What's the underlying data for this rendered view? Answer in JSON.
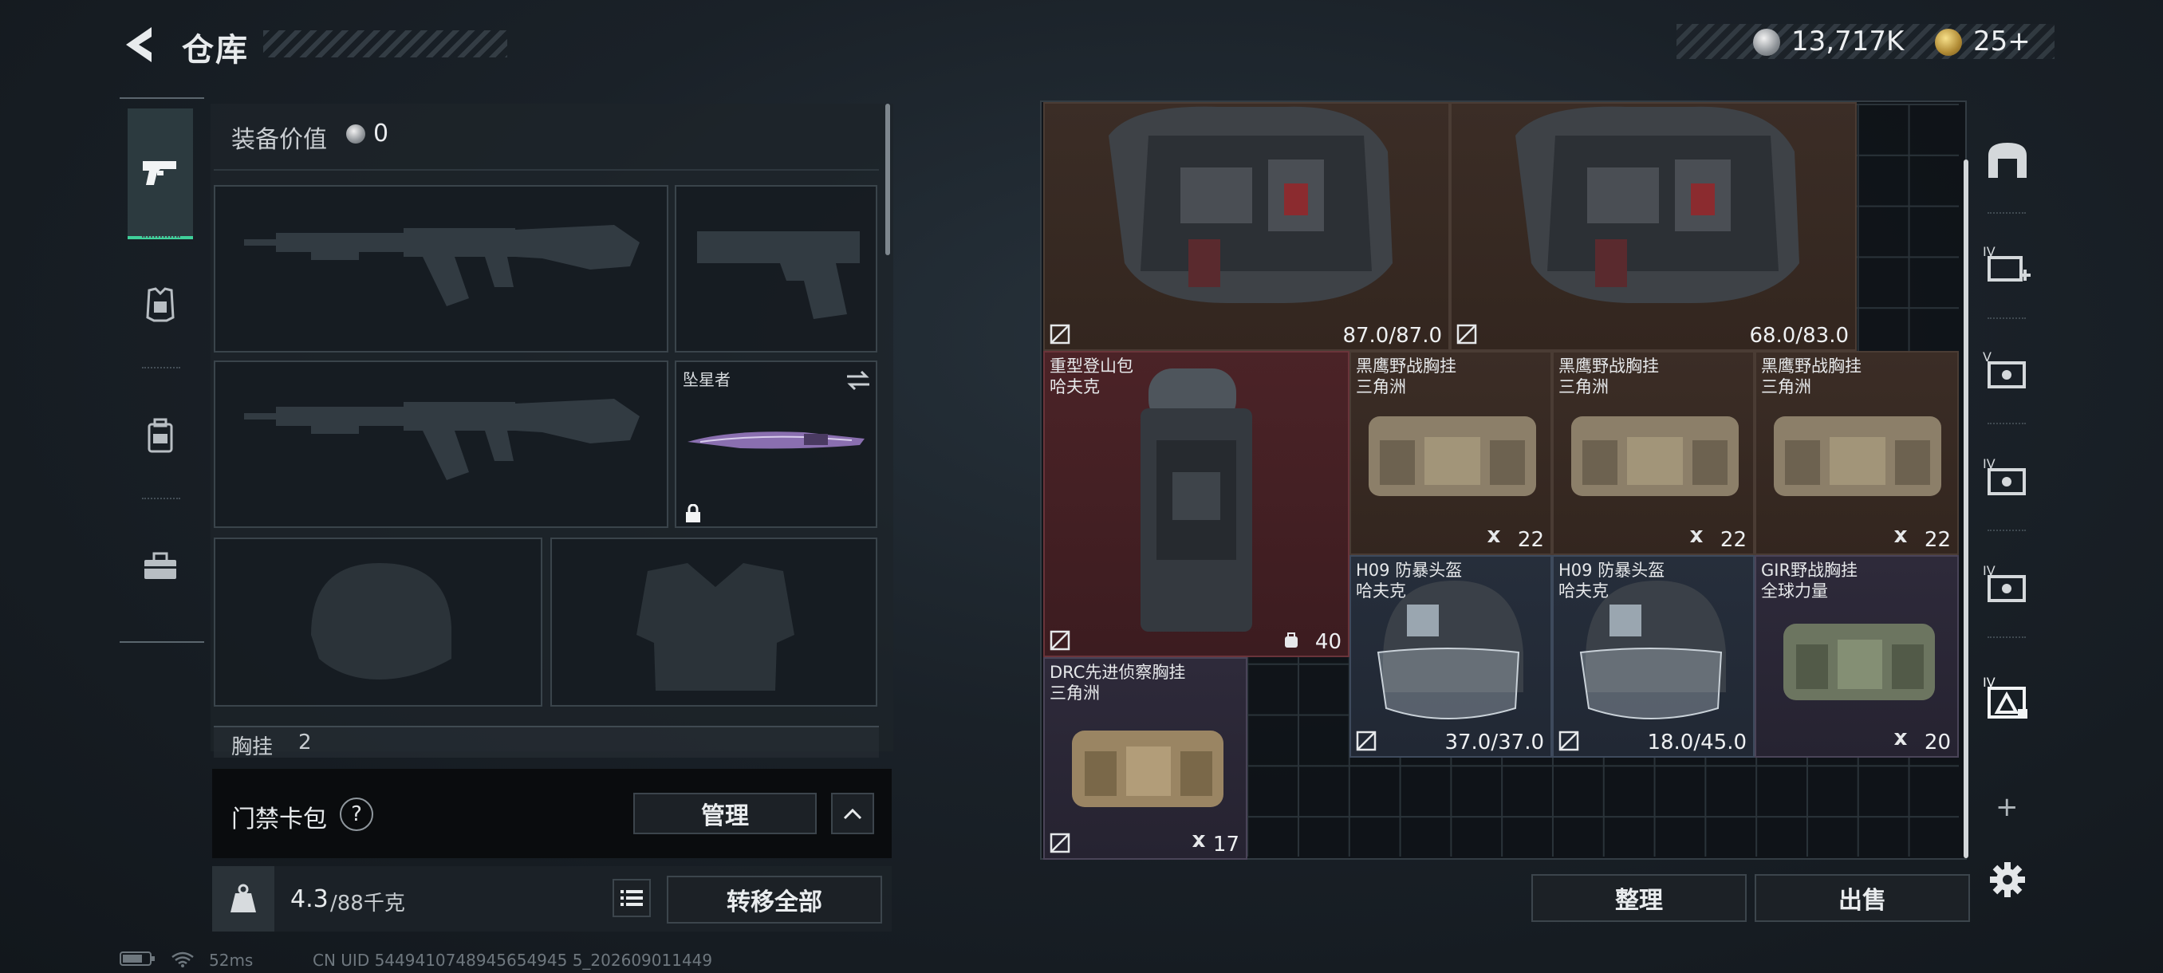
{
  "header": {
    "title": "仓库",
    "currency_primary": "13,717K",
    "currency_secondary": "25+"
  },
  "left_nav": {
    "tabs": [
      {
        "name": "weapon",
        "icon": "pistol-icon",
        "active": true
      },
      {
        "name": "armor",
        "icon": "armor-vest-icon",
        "active": false
      },
      {
        "name": "backpack",
        "icon": "backpack-icon",
        "active": false
      },
      {
        "name": "toolbox",
        "icon": "toolbox-icon",
        "active": false
      }
    ]
  },
  "equipment": {
    "value_label": "装备价值",
    "value": "0",
    "melee_name": "坠星者",
    "chest_label": "胸挂",
    "chest_count": "2"
  },
  "keycard": {
    "label": "门禁卡包",
    "help": "?",
    "manage_label": "管理"
  },
  "capacity": {
    "current": "4.3",
    "max_unit": "/88千克",
    "transfer_all_label": "转移全部"
  },
  "storage": {
    "items": [
      {
        "id": "armor1",
        "name1": "",
        "name2": "",
        "value": "87.0/87.0",
        "type": "durability",
        "color": "brown"
      },
      {
        "id": "armor2",
        "name1": "",
        "name2": "",
        "value": "68.0/83.0",
        "type": "durability",
        "color": "brown"
      },
      {
        "id": "backpack",
        "name1": "重型登山包",
        "name2": "哈夫克",
        "value": "40",
        "type": "capacity",
        "color": "red"
      },
      {
        "id": "rig1",
        "name1": "黑鹰野战胸挂",
        "name2": "三角洲",
        "value": "22",
        "type": "slots",
        "color": "brown"
      },
      {
        "id": "rig2",
        "name1": "黑鹰野战胸挂",
        "name2": "三角洲",
        "value": "22",
        "type": "slots",
        "color": "brown"
      },
      {
        "id": "rig3",
        "name1": "黑鹰野战胸挂",
        "name2": "三角洲",
        "value": "22",
        "type": "slots",
        "color": "brown"
      },
      {
        "id": "helmet1",
        "name1": "H09 防暴头盔",
        "name2": "哈夫克",
        "value": "37.0/37.0",
        "type": "durability",
        "color": "blue"
      },
      {
        "id": "helmet2",
        "name1": "H09 防暴头盔",
        "name2": "哈夫克",
        "value": "18.0/45.0",
        "type": "durability",
        "color": "blue"
      },
      {
        "id": "rig4",
        "name1": "GIR野战胸挂",
        "name2": "全球力量",
        "value": "20",
        "type": "slots",
        "color": "purple"
      },
      {
        "id": "rig5",
        "name1": "DRC先进侦察胸挂",
        "name2": "三角洲",
        "value": "17",
        "type": "slots",
        "color": "purple"
      }
    ],
    "sort_label": "整理",
    "sell_label": "出售"
  },
  "right_nav": {
    "tabs": [
      {
        "name": "home",
        "icon": "storage-home-icon"
      },
      {
        "name": "IV-add",
        "icon": "expand-storage-icon",
        "label": "IV"
      },
      {
        "name": "V",
        "icon": "storage-tab-icon",
        "label": "V"
      },
      {
        "name": "IV-a",
        "icon": "storage-tab-icon",
        "label": "IV"
      },
      {
        "name": "IV-b",
        "icon": "storage-tab-icon",
        "label": "IV"
      },
      {
        "name": "IV-c",
        "icon": "storage-tab-icon",
        "label": "IV"
      }
    ],
    "add": "+",
    "settings": "gear-icon"
  },
  "status": {
    "ping": "52ms",
    "uid": "CN UID 5449410748945654945 5_202609011449"
  },
  "colors": {
    "accent_green": "#3fd09a",
    "item_brown": "#3b2d26",
    "item_red": "#4b2327",
    "item_purple": "#2e2a3a",
    "item_blue": "#262e3b"
  }
}
